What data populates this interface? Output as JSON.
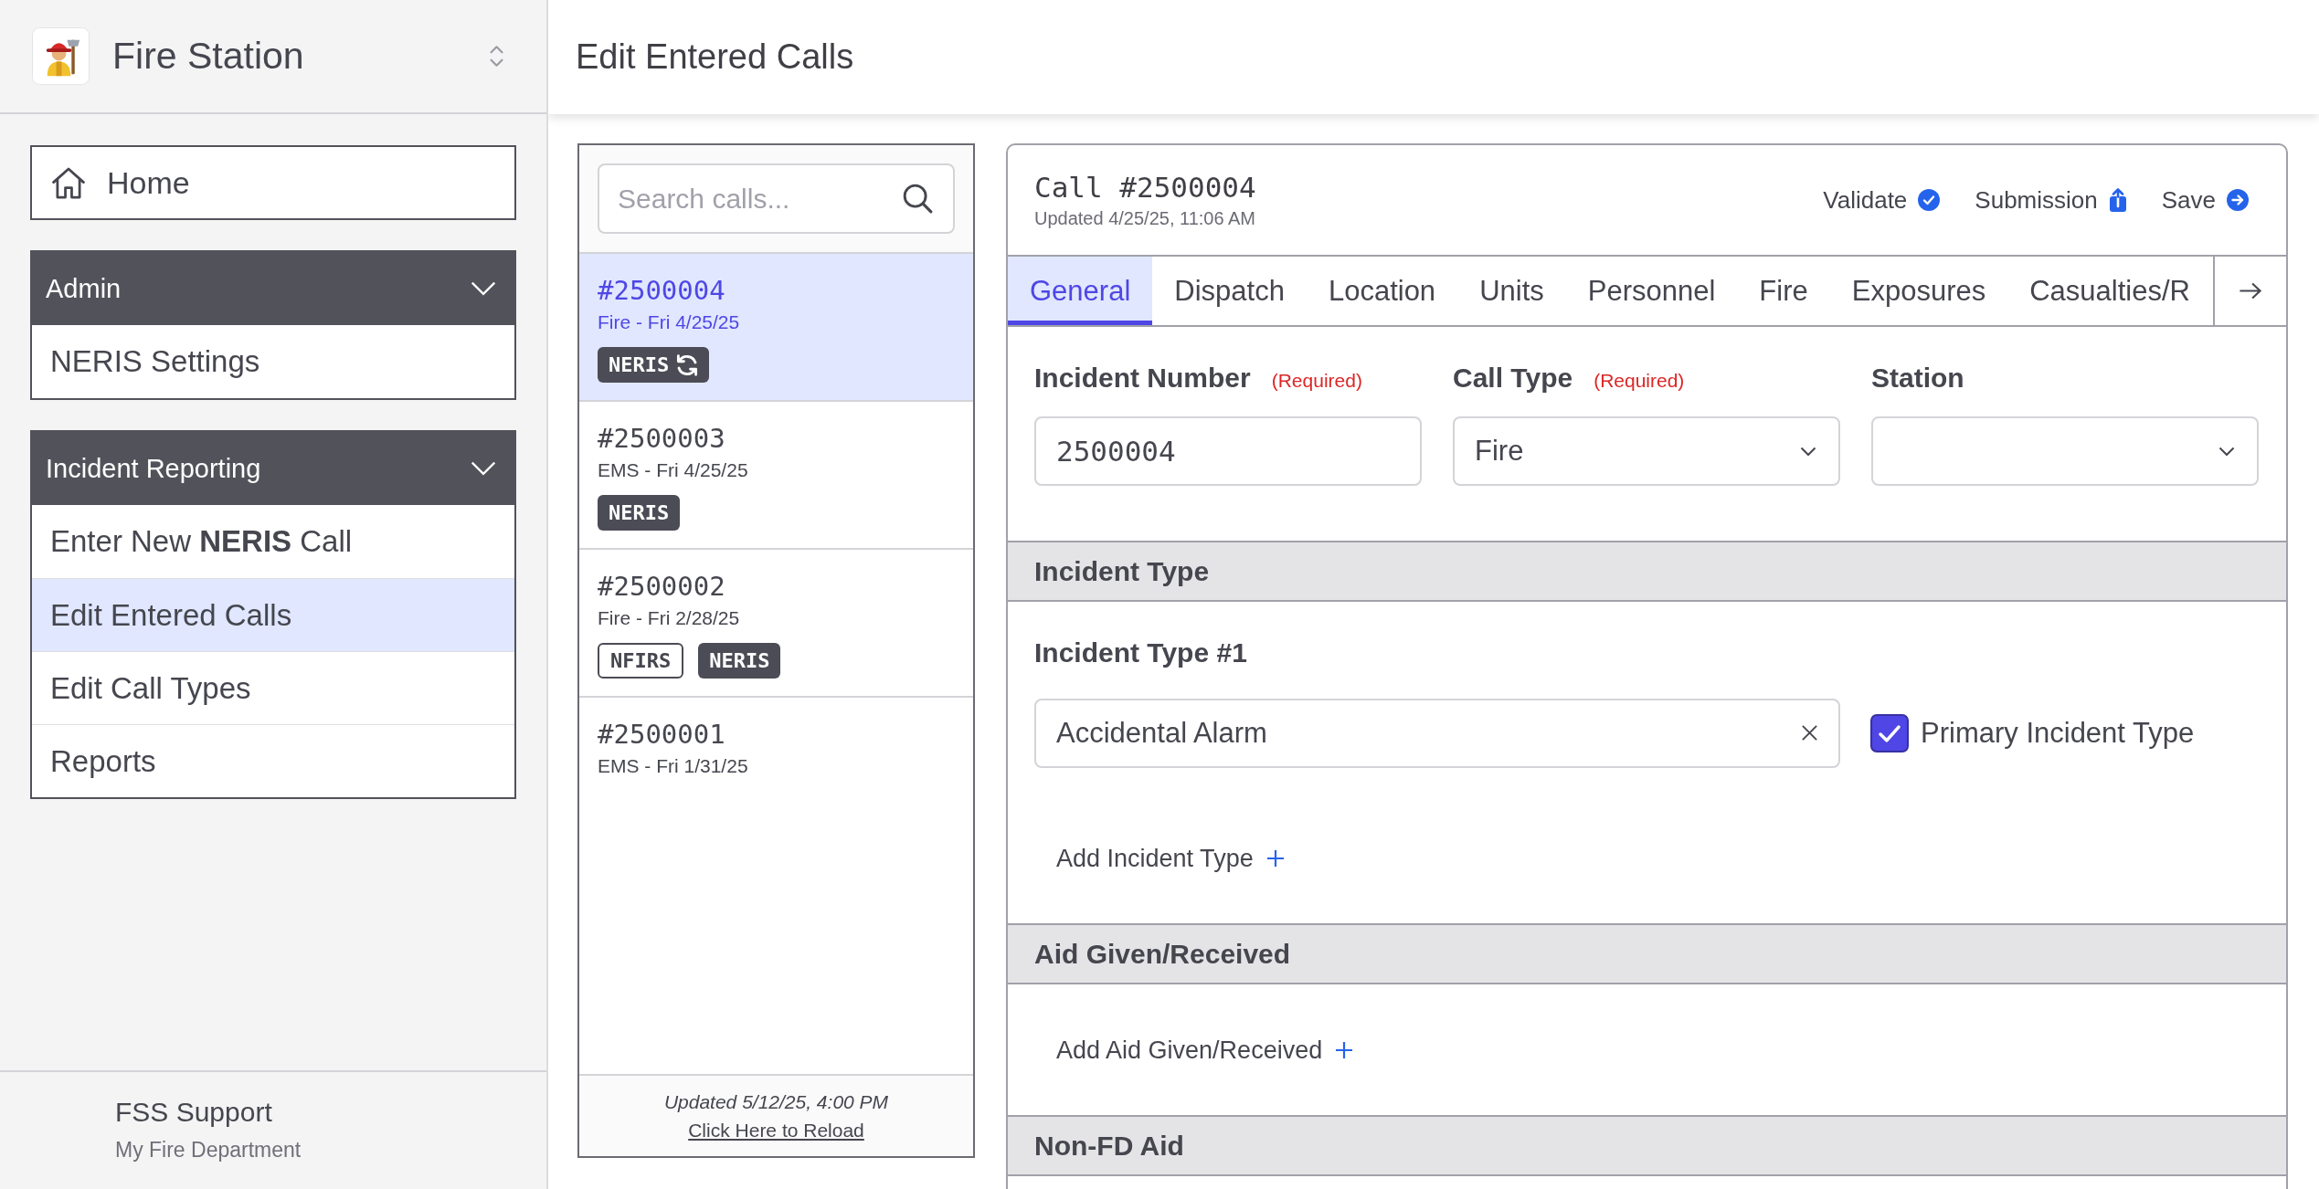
{
  "sidebar": {
    "app_title": "Fire Station",
    "home": {
      "label": "Home",
      "selected": false
    },
    "groups": [
      {
        "title": "Admin",
        "expanded": true,
        "items": [
          {
            "label": "NERIS Settings",
            "selected": false
          }
        ]
      },
      {
        "title": "Incident Reporting",
        "expanded": true,
        "items": [
          {
            "label": "Enter New **NERIS** Call",
            "selected": false
          },
          {
            "label": "Edit Entered Calls",
            "selected": true
          },
          {
            "label": "Edit Call Types",
            "selected": false
          },
          {
            "label": "Reports",
            "selected": false
          }
        ]
      }
    ],
    "footer": {
      "user": "FSS Support",
      "organization": "My Fire Department"
    }
  },
  "page_title": "Edit Entered Calls",
  "call_list": {
    "search": {
      "placeholder": "Search calls..."
    },
    "calls": [
      {
        "number": "#2500004",
        "summary": "Fire - Fri 4/25/25",
        "selected": true,
        "badges": [
          {
            "label": "NERIS",
            "kind": "filled",
            "syncing": true
          }
        ]
      },
      {
        "number": "#2500003",
        "summary": "EMS - Fri 4/25/25",
        "selected": false,
        "badges": [
          {
            "label": "NERIS",
            "kind": "filled",
            "syncing": false
          }
        ]
      },
      {
        "number": "#2500002",
        "summary": "Fire - Fri 2/28/25",
        "selected": false,
        "badges": [
          {
            "label": "NFIRS",
            "kind": "outline",
            "syncing": false
          },
          {
            "label": "NERIS",
            "kind": "filled",
            "syncing": false
          }
        ]
      },
      {
        "number": "#2500001",
        "summary": "EMS - Fri 1/31/25",
        "selected": false
      }
    ],
    "footer": {
      "updated": "Updated 5/12/25, 4:00 PM",
      "reload_link": "Click Here to Reload"
    }
  },
  "call": {
    "title": "Call #2500004",
    "updated": "Updated 4/25/25, 11:06 AM",
    "actions": [
      {
        "label": "Validate",
        "kind": "validate"
      },
      {
        "label": "Submission",
        "kind": "submission"
      },
      {
        "label": "Save",
        "kind": "save"
      }
    ],
    "tabs": [
      {
        "label": "General",
        "selected": true
      },
      {
        "label": "Dispatch",
        "selected": false
      },
      {
        "label": "Location",
        "selected": false
      },
      {
        "label": "Units",
        "selected": false
      },
      {
        "label": "Personnel",
        "selected": false
      },
      {
        "label": "Fire",
        "selected": false
      },
      {
        "label": "Exposures",
        "selected": false
      },
      {
        "label": "Casualties/R",
        "selected": false
      }
    ],
    "fields": [
      {
        "label": "Incident Number",
        "required_note": "(Required)",
        "kind": "text",
        "value": "2500004"
      },
      {
        "label": "Call Type",
        "required_note": "(Required)",
        "kind": "select",
        "value": "Fire"
      },
      {
        "label": "Station",
        "kind": "select"
      }
    ],
    "sections": [
      {
        "title": "Incident Type",
        "entries": [
          {
            "label": "Incident Type #1",
            "value": "Accidental Alarm",
            "primary": {
              "label": "Primary Incident Type",
              "checked": true
            }
          }
        ],
        "add_label": "Add Incident Type"
      },
      {
        "title": "Aid Given/Received",
        "add_label": "Add Aid Given/Received"
      },
      {
        "title": "Non-FD Aid"
      }
    ]
  }
}
